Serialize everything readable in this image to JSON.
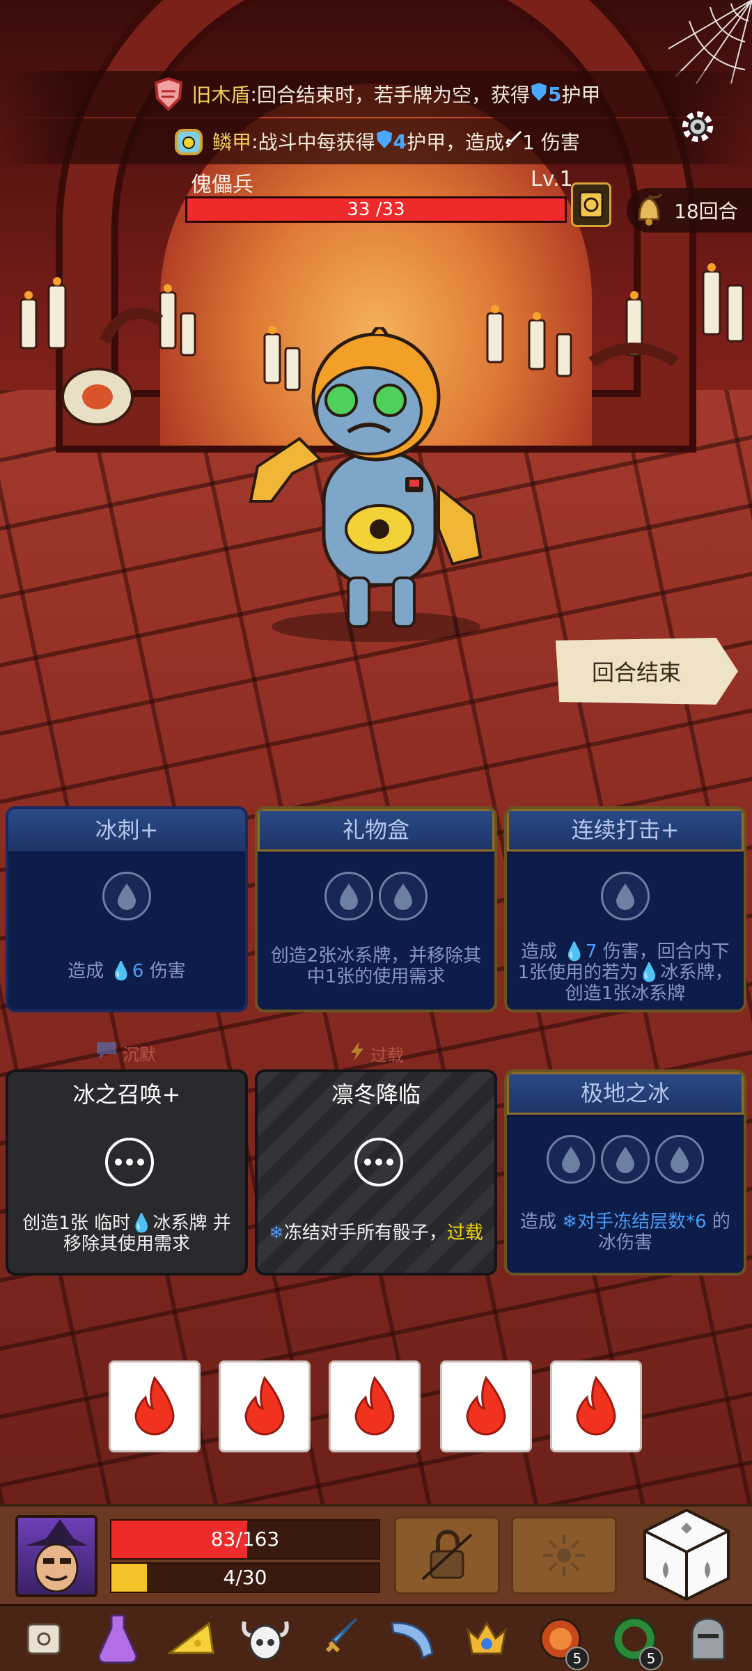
{
  "relics": [
    {
      "name": "旧木盾",
      "sep": ": ",
      "text_before": "回合结束时，若手牌为空，获得 ",
      "shield_value": "5",
      "text_after": " 护甲"
    },
    {
      "name": "鳞甲",
      "sep": ": ",
      "text_before": "战斗中每获得",
      "shield_value": "4",
      "text_mid": "护甲，造成 ",
      "text_after": "1 伤害"
    }
  ],
  "enemy": {
    "name": "傀儡兵",
    "level": "Lv.1",
    "hp_text": "33 /33",
    "hp_fraction": 1.0
  },
  "turn": {
    "label": "18回合"
  },
  "end_turn": {
    "label": "回合结束"
  },
  "cards": [
    {
      "title": "冰刺+",
      "desc_pre": "造成 ",
      "desc_value": "6",
      "desc_post": " 伤害",
      "cost": 1
    },
    {
      "title": "礼物盒",
      "desc": "创造2张冰系牌，并移除其中1张的使用需求",
      "cost": 2
    },
    {
      "title": "连续打击+",
      "desc_pre": "造成 ",
      "desc_value": "7",
      "desc_post": " 伤害，回合内下1张使用的若为",
      "desc_post2": "冰系牌，创造1张冰系牌",
      "cost": 1
    },
    {
      "title": "冰之召唤+",
      "desc_pre": "创造1张 临时",
      "desc_post": "冰系牌 并移除其使用需求"
    },
    {
      "title": "凛冬降临",
      "desc_pre": "冻结对手所有骰子，",
      "desc_hl": "过载"
    },
    {
      "title": "极地之冰",
      "desc_pre": "造成 ",
      "desc_hl": "对手冻结层数*6",
      "desc_post": " 的冰伤害",
      "cost": 3
    }
  ],
  "card_tags": [
    {
      "label": "沉默",
      "icon": "speech-bubble-icon"
    },
    {
      "label": "过载",
      "icon": "lightning-icon"
    }
  ],
  "dice": [
    {
      "icon": "fire-icon"
    },
    {
      "icon": "fire-icon"
    },
    {
      "icon": "fire-icon"
    },
    {
      "icon": "fire-icon"
    },
    {
      "icon": "fire-icon"
    }
  ],
  "player": {
    "hp_text": "83/163",
    "hp_fraction": 0.509,
    "energy_text": "4/30",
    "energy_fraction": 0.133
  },
  "items": [
    {
      "icon": "scroll-icon"
    },
    {
      "icon": "potion-flask-icon"
    },
    {
      "icon": "cheese-icon"
    },
    {
      "icon": "horned-skull-icon"
    },
    {
      "icon": "crystal-sword-icon"
    },
    {
      "icon": "horn-icon"
    },
    {
      "icon": "gold-crown-gem-icon"
    },
    {
      "icon": "lava-orb-icon",
      "badge": "5"
    },
    {
      "icon": "green-ring-icon",
      "badge": "5"
    },
    {
      "icon": "knight-helmet-icon"
    }
  ],
  "colors": {
    "enemy_hp": "#ef2a2a",
    "player_hp": "#ef2a2a",
    "energy": "#f6c22a",
    "ice_card": "#0e1c4a",
    "shield_blue": "#4aa8ff",
    "highlight_yellow": "#f6d800"
  }
}
